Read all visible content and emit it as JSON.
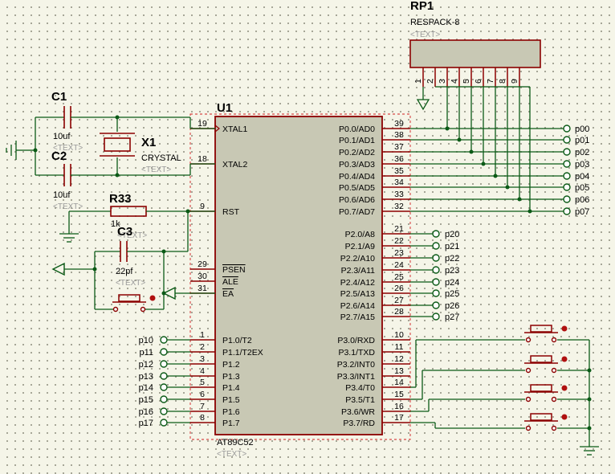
{
  "chip": {
    "ref": "U1",
    "part": "AT89C52",
    "text": "<TEXT>",
    "left_pins": [
      {
        "num": "19",
        "name": "XTAL1"
      },
      {
        "num": "18",
        "name": "XTAL2"
      },
      {
        "num": "9",
        "name": "RST"
      },
      {
        "num": "29",
        "name": "PSEN"
      },
      {
        "num": "30",
        "name": "ALE"
      },
      {
        "num": "31",
        "name": "EA"
      },
      {
        "num": "1",
        "name": "P1.0/T2"
      },
      {
        "num": "2",
        "name": "P1.1/T2EX"
      },
      {
        "num": "3",
        "name": "P1.2"
      },
      {
        "num": "4",
        "name": "P1.3"
      },
      {
        "num": "5",
        "name": "P1.4"
      },
      {
        "num": "6",
        "name": "P1.5"
      },
      {
        "num": "7",
        "name": "P1.6"
      },
      {
        "num": "8",
        "name": "P1.7"
      }
    ],
    "right_pins": [
      {
        "num": "39",
        "name": "P0.0/AD0"
      },
      {
        "num": "38",
        "name": "P0.1/AD1"
      },
      {
        "num": "37",
        "name": "P0.2/AD2"
      },
      {
        "num": "36",
        "name": "P0.3/AD3"
      },
      {
        "num": "35",
        "name": "P0.4/AD4"
      },
      {
        "num": "34",
        "name": "P0.5/AD5"
      },
      {
        "num": "33",
        "name": "P0.6/AD6"
      },
      {
        "num": "32",
        "name": "P0.7/AD7"
      },
      {
        "num": "21",
        "name": "P2.0/A8"
      },
      {
        "num": "22",
        "name": "P2.1/A9"
      },
      {
        "num": "23",
        "name": "P2.2/A10"
      },
      {
        "num": "24",
        "name": "P2.3/A11"
      },
      {
        "num": "25",
        "name": "P2.4/A12"
      },
      {
        "num": "26",
        "name": "P2.5/A13"
      },
      {
        "num": "27",
        "name": "P2.6/A14"
      },
      {
        "num": "28",
        "name": "P2.7/A15"
      },
      {
        "num": "10",
        "name": "P3.0/RXD"
      },
      {
        "num": "11",
        "name": "P3.1/TXD"
      },
      {
        "num": "12",
        "name": "P3.2/INT0"
      },
      {
        "num": "13",
        "name": "P3.3/INT1"
      },
      {
        "num": "14",
        "name": "P3.4/T0"
      },
      {
        "num": "15",
        "name": "P3.5/T1"
      },
      {
        "num": "16",
        "name": "P3.6/WR"
      },
      {
        "num": "17",
        "name": "P3.7/RD"
      }
    ]
  },
  "rp1": {
    "ref": "RP1",
    "part": "RESPACK-8",
    "text": "<TEXT>",
    "pins": [
      "1",
      "2",
      "3",
      "4",
      "5",
      "6",
      "7",
      "8",
      "9"
    ]
  },
  "c1": {
    "ref": "C1",
    "value": "10uf",
    "text": "<TEXT>"
  },
  "c2": {
    "ref": "C2",
    "value": "10uf",
    "text": "<TEXT>"
  },
  "x1": {
    "ref": "X1",
    "value": "CRYSTAL",
    "text": "<TEXT>"
  },
  "r33": {
    "ref": "R33",
    "value": "1k",
    "text": "<TEXT>"
  },
  "c3": {
    "ref": "C3",
    "value": "22pf",
    "text": "<TEXT>"
  },
  "p0_terminals": [
    "p00",
    "p01",
    "p02",
    "p03",
    "p04",
    "p05",
    "p06",
    "p07"
  ],
  "p2_terminals": [
    "p20",
    "p21",
    "p22",
    "p23",
    "p24",
    "p25",
    "p26",
    "p27"
  ],
  "p1_terminals": [
    "p10",
    "p11",
    "p12",
    "p13",
    "p14",
    "p15",
    "p16",
    "p17"
  ]
}
